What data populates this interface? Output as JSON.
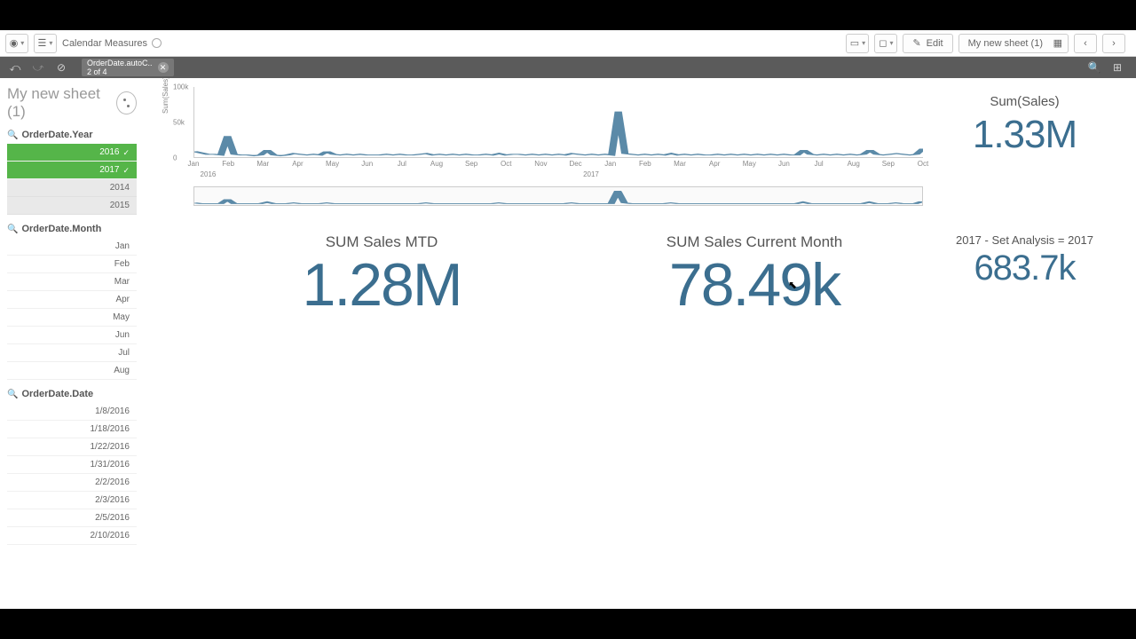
{
  "toolbar": {
    "app_name": "Calendar Measures",
    "edit": "Edit",
    "sheet": "My new sheet (1)"
  },
  "selection": {
    "field": "OrderDate.autoC..",
    "count": "2 of 4"
  },
  "sheet_title": "My new sheet (1)",
  "filters": {
    "year": {
      "title": "OrderDate.Year",
      "items": [
        {
          "label": "2016",
          "selected": true
        },
        {
          "label": "2017",
          "selected": true
        },
        {
          "label": "2014",
          "alt": true
        },
        {
          "label": "2015",
          "alt": true
        }
      ]
    },
    "month": {
      "title": "OrderDate.Month",
      "items": [
        "Jan",
        "Feb",
        "Mar",
        "Apr",
        "May",
        "Jun",
        "Jul",
        "Aug"
      ]
    },
    "date": {
      "title": "OrderDate.Date",
      "items": [
        "1/8/2016",
        "1/18/2016",
        "1/22/2016",
        "1/31/2016",
        "2/2/2016",
        "2/3/2016",
        "2/5/2016",
        "2/10/2016"
      ]
    }
  },
  "kpi": {
    "mtd_label": "SUM Sales MTD",
    "mtd_value": "1.28M",
    "cm_label": "SUM Sales Current Month",
    "cm_value": "78.49k",
    "sum_label": "Sum(Sales)",
    "sum_value": "1.33M",
    "set_label": "2017 - Set Analysis = 2017",
    "set_value": "683.7k"
  },
  "chart_data": {
    "type": "line",
    "ylabel": "Sum(Sales)",
    "ylim": [
      0,
      100000
    ],
    "yticks": [
      0,
      50000,
      100000
    ],
    "ytick_labels": [
      "0",
      "50k",
      "100k"
    ],
    "x_months": [
      "Jan",
      "Feb",
      "Mar",
      "Apr",
      "May",
      "Jun",
      "Jul",
      "Aug",
      "Sep",
      "Oct",
      "Nov",
      "Dec",
      "Jan",
      "Feb",
      "Mar",
      "Apr",
      "May",
      "Jun",
      "Jul",
      "Aug",
      "Sep",
      "Oct"
    ],
    "x_year_labels": [
      {
        "label": "2016",
        "pos": 0.02
      },
      {
        "label": "2017",
        "pos": 0.545
      }
    ],
    "values": [
      8,
      6,
      4,
      4,
      3,
      30,
      4,
      3,
      3,
      2,
      3,
      10,
      3,
      2,
      3,
      5,
      4,
      3,
      4,
      3,
      8,
      4,
      3,
      4,
      3,
      4,
      3,
      3,
      3,
      4,
      3,
      4,
      3,
      3,
      4,
      5,
      3,
      4,
      3,
      4,
      3,
      4,
      3,
      3,
      4,
      3,
      5,
      3,
      4,
      4,
      3,
      4,
      3,
      4,
      3,
      4,
      3,
      5,
      4,
      3,
      4,
      3,
      4,
      3,
      65,
      5,
      4,
      3,
      4,
      3,
      4,
      3,
      5,
      3,
      4,
      3,
      4,
      3,
      3,
      4,
      3,
      4,
      3,
      4,
      3,
      4,
      3,
      4,
      3,
      4,
      3,
      3,
      10,
      4,
      3,
      4,
      3,
      4,
      3,
      4,
      3,
      4,
      10,
      4,
      3,
      4,
      5,
      4,
      3,
      4,
      12
    ],
    "scrubber_values": [
      3,
      2,
      2,
      2,
      2,
      8,
      2,
      2,
      2,
      2,
      2,
      4,
      2,
      2,
      2,
      3,
      2,
      2,
      2,
      2,
      3,
      2,
      2,
      2,
      2,
      2,
      2,
      2,
      2,
      2,
      2,
      2,
      2,
      2,
      2,
      3,
      2,
      2,
      2,
      2,
      2,
      2,
      2,
      2,
      2,
      2,
      3,
      2,
      2,
      2,
      2,
      2,
      2,
      2,
      2,
      2,
      2,
      3,
      2,
      2,
      2,
      2,
      2,
      2,
      20,
      3,
      2,
      2,
      2,
      2,
      2,
      2,
      3,
      2,
      2,
      2,
      2,
      2,
      2,
      2,
      2,
      2,
      2,
      2,
      2,
      2,
      2,
      2,
      2,
      2,
      2,
      2,
      4,
      2,
      2,
      2,
      2,
      2,
      2,
      2,
      2,
      2,
      4,
      2,
      2,
      2,
      3,
      2,
      2,
      2,
      5
    ]
  }
}
